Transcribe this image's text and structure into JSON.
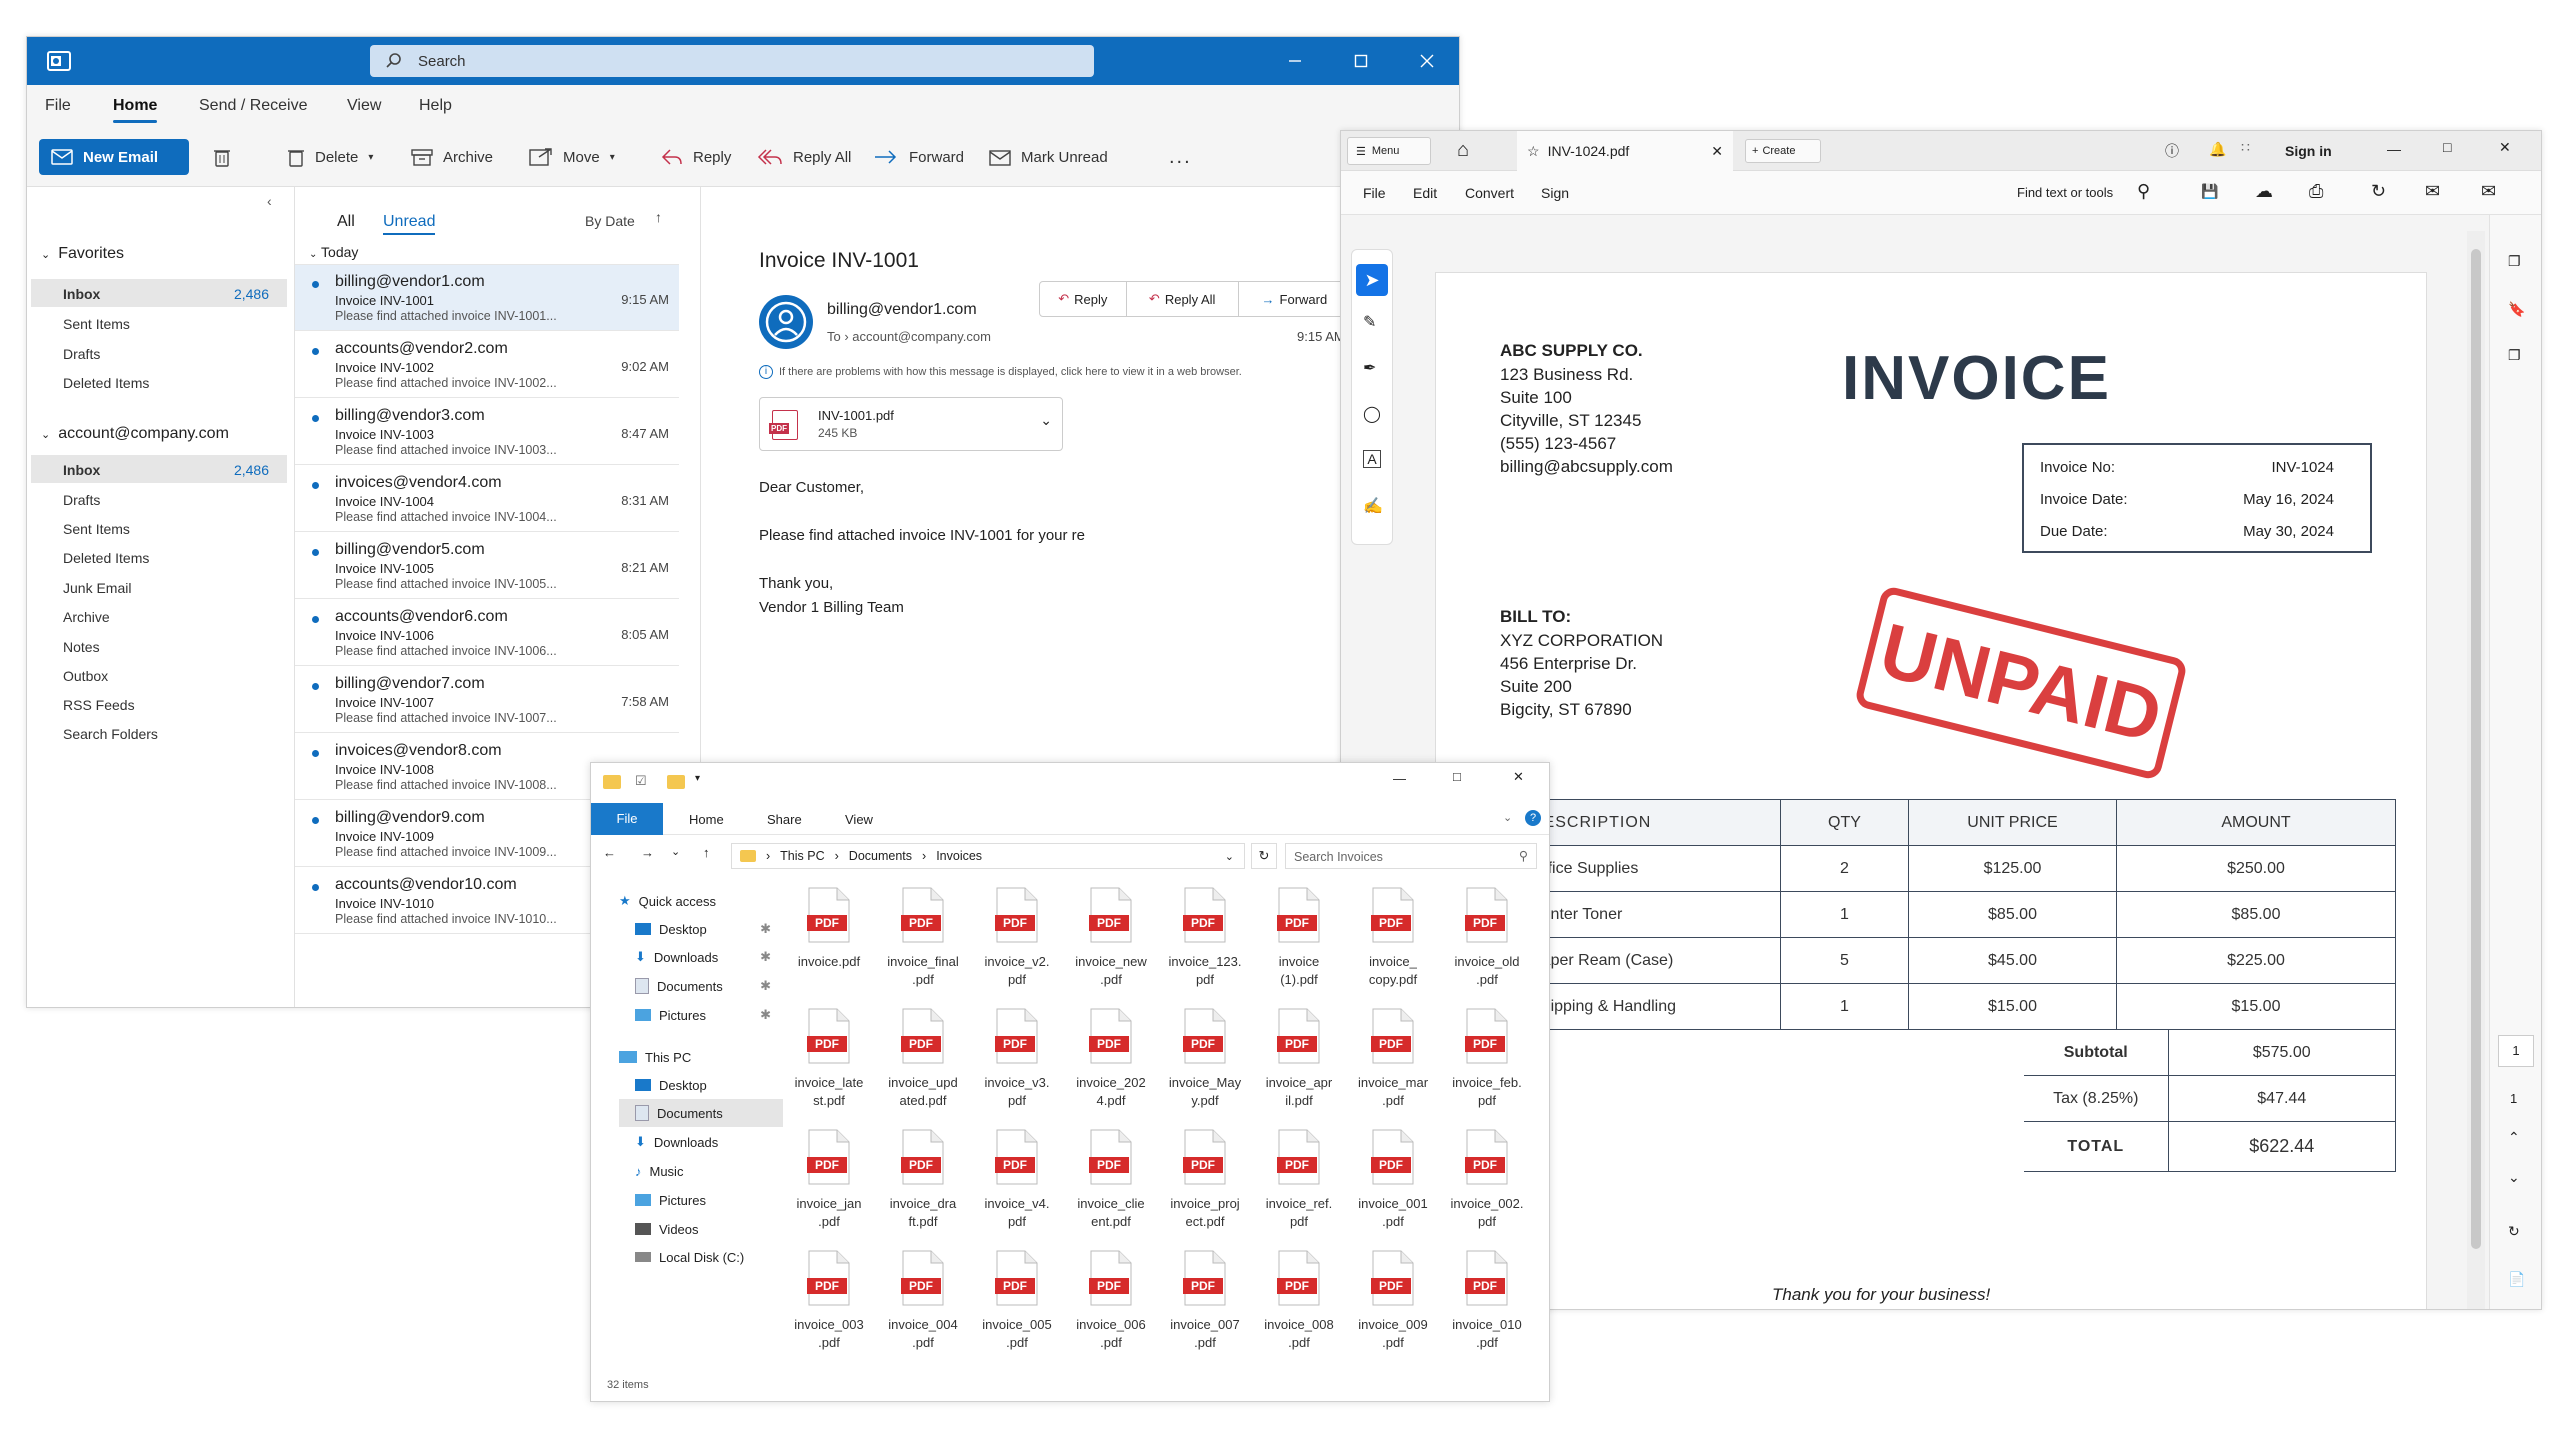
{
  "outlook": {
    "search_placeholder": "Search",
    "menu": [
      "File",
      "Home",
      "Send / Receive",
      "View",
      "Help"
    ],
    "ribbon": {
      "new_email": "New Email",
      "delete": "Delete",
      "archive": "Archive",
      "move": "Move",
      "reply": "Reply",
      "reply_all": "Reply All",
      "forward": "Forward",
      "mark_unread": "Mark Unread",
      "more": "..."
    },
    "favorites": {
      "header": "Favorites",
      "items": [
        {
          "label": "Inbox",
          "count": "2,486"
        },
        {
          "label": "Sent Items"
        },
        {
          "label": "Drafts"
        },
        {
          "label": "Deleted Items"
        }
      ]
    },
    "account": {
      "header": "account@company.com",
      "items": [
        {
          "label": "Inbox",
          "count": "2,486"
        },
        {
          "label": "Drafts"
        },
        {
          "label": "Sent Items"
        },
        {
          "label": "Deleted Items"
        },
        {
          "label": "Junk Email"
        },
        {
          "label": "Archive"
        },
        {
          "label": "Notes"
        },
        {
          "label": "Outbox"
        },
        {
          "label": "RSS Feeds"
        },
        {
          "label": "Search Folders"
        }
      ]
    },
    "list": {
      "tab_all": "All",
      "tab_unread": "Unread",
      "sort": "By Date",
      "group": "Today",
      "messages": [
        {
          "from": "billing@vendor1.com",
          "subject": "Invoice INV-1001",
          "preview": "Please find attached invoice INV-1001...",
          "time": "9:15 AM"
        },
        {
          "from": "accounts@vendor2.com",
          "subject": "Invoice INV-1002",
          "preview": "Please find attached invoice INV-1002...",
          "time": "9:02 AM"
        },
        {
          "from": "billing@vendor3.com",
          "subject": "Invoice INV-1003",
          "preview": "Please find attached invoice INV-1003...",
          "time": "8:47 AM"
        },
        {
          "from": "invoices@vendor4.com",
          "subject": "Invoice INV-1004",
          "preview": "Please find attached invoice INV-1004...",
          "time": "8:31 AM"
        },
        {
          "from": "billing@vendor5.com",
          "subject": "Invoice INV-1005",
          "preview": "Please find attached invoice INV-1005...",
          "time": "8:21 AM"
        },
        {
          "from": "accounts@vendor6.com",
          "subject": "Invoice INV-1006",
          "preview": "Please find attached invoice INV-1006...",
          "time": "8:05 AM"
        },
        {
          "from": "billing@vendor7.com",
          "subject": "Invoice INV-1007",
          "preview": "Please find attached invoice INV-1007...",
          "time": "7:58 AM"
        },
        {
          "from": "invoices@vendor8.com",
          "subject": "Invoice INV-1008",
          "preview": "Please find attached invoice INV-1008...",
          "time": ""
        },
        {
          "from": "billing@vendor9.com",
          "subject": "Invoice INV-1009",
          "preview": "Please find attached invoice INV-1009...",
          "time": ""
        },
        {
          "from": "accounts@vendor10.com",
          "subject": "Invoice INV-1010",
          "preview": "Please find attached invoice INV-1010...",
          "time": ""
        }
      ]
    },
    "reading": {
      "subject": "Invoice INV-1001",
      "from": "billing@vendor1.com",
      "to_label": "To",
      "to": "account@company.com",
      "time": "9:15 AM",
      "reply": "Reply",
      "reply_all": "Reply All",
      "forward": "Forward",
      "info": "If there are problems with how this message is displayed, click here to view it in a web browser.",
      "attachment_name": "INV-1001.pdf",
      "attachment_size": "245 KB",
      "greeting": "Dear Customer,",
      "body": "Please find attached invoice INV-1001 for your re",
      "closing": "Thank you,",
      "signature": "Vendor 1 Billing Team"
    }
  },
  "acrobat": {
    "tab_menu": "Menu",
    "tab_file": "INV-1024.pdf",
    "create": "Create",
    "sign_in": "Sign in",
    "menu": [
      "File",
      "Edit",
      "Convert",
      "Sign"
    ],
    "find": "Find text or tools",
    "page_number": "1",
    "page_total": "1",
    "invoice": {
      "company": "ABC SUPPLY CO.",
      "address": [
        "123 Business Rd.",
        "Suite 100",
        "Cityville, ST 12345",
        "(555) 123-4567",
        "billing@abcsupply.com"
      ],
      "title": "INVOICE",
      "meta": [
        {
          "label": "Invoice No:",
          "value": "INV-1024"
        },
        {
          "label": "Invoice Date:",
          "value": "May 16, 2024"
        },
        {
          "label": "Due Date:",
          "value": "May 30, 2024"
        }
      ],
      "bill_to_label": "BILL TO:",
      "bill_to": [
        "XYZ CORPORATION",
        "456 Enterprise Dr.",
        "Suite 200",
        "Bigcity, ST 67890"
      ],
      "stamp": "UNPAID",
      "columns": [
        "DESCRIPTION",
        "QTY",
        "UNIT PRICE",
        "AMOUNT"
      ],
      "rows": [
        [
          "Office Supplies",
          "2",
          "$125.00",
          "$250.00"
        ],
        [
          "Printer Toner",
          "1",
          "$85.00",
          "$85.00"
        ],
        [
          "Paper Ream (Case)",
          "5",
          "$45.00",
          "$225.00"
        ],
        [
          "Shipping & Handling",
          "1",
          "$15.00",
          "$15.00"
        ]
      ],
      "subtotal_label": "Subtotal",
      "subtotal": "$575.00",
      "tax_label": "Tax (8.25%)",
      "tax": "$47.44",
      "total_label": "TOTAL",
      "total": "$622.44",
      "thanks": "Thank you for your business!"
    }
  },
  "explorer": {
    "ribbon": [
      "File",
      "Home",
      "Share",
      "View"
    ],
    "breadcrumb": [
      "This PC",
      "Documents",
      "Invoices"
    ],
    "search_placeholder": "Search Invoices",
    "nav": {
      "quick_access": "Quick access",
      "quick": [
        "Desktop",
        "Downloads",
        "Documents",
        "Pictures"
      ],
      "this_pc": "This PC",
      "pc": [
        "Desktop",
        "Documents",
        "Downloads",
        "Music",
        "Pictures",
        "Videos",
        "Local Disk (C:)"
      ]
    },
    "files": [
      "invoice.pdf",
      "invoice_final\n.pdf",
      "invoice_v2.\npdf",
      "invoice_new\n.pdf",
      "invoice_123.\npdf",
      "invoice\n(1).pdf",
      "invoice_\ncopy.pdf",
      "invoice_old\n.pdf",
      "invoice_late\nst.pdf",
      "invoice_upd\nated.pdf",
      "invoice_v3.\npdf",
      "invoice_202\n4.pdf",
      "invoice_May\ny.pdf",
      "invoice_apr\nil.pdf",
      "invoice_mar\n.pdf",
      "invoice_feb.\npdf",
      "invoice_jan\n.pdf",
      "invoice_dra\nft.pdf",
      "invoice_v4.\npdf",
      "invoice_clie\nent.pdf",
      "invoice_proj\nect.pdf",
      "invoice_ref.\npdf",
      "invoice_001\n.pdf",
      "invoice_002.\npdf",
      "invoice_003\n.pdf",
      "invoice_004\n.pdf",
      "invoice_005\n.pdf",
      "invoice_006\n.pdf",
      "invoice_007\n.pdf",
      "invoice_008\n.pdf",
      "invoice_009\n.pdf",
      "invoice_010\n.pdf"
    ],
    "pdf_badge": "PDF",
    "status": "32 items"
  }
}
